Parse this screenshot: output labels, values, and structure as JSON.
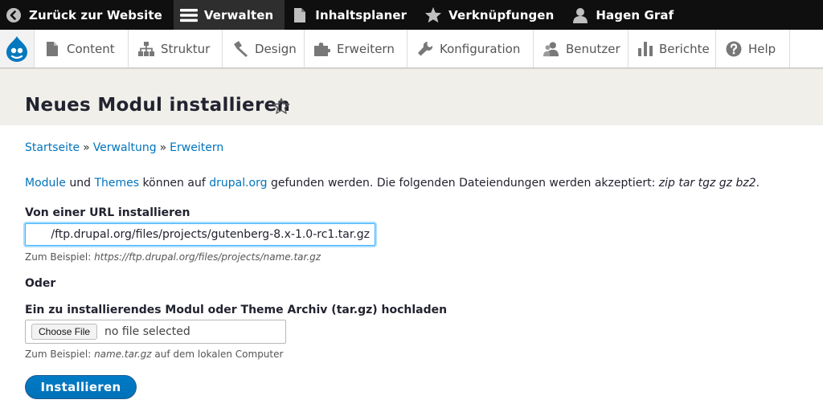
{
  "toolbar": {
    "back_label": "Zurück zur Website",
    "manage_label": "Verwalten",
    "content_planner_label": "Inhaltsplaner",
    "shortcuts_label": "Verknüpfungen",
    "user_label": "Hagen Graf"
  },
  "admin_menu": {
    "items": [
      {
        "label": "Content",
        "icon": "page-icon"
      },
      {
        "label": "Struktur",
        "icon": "structure-icon"
      },
      {
        "label": "Design",
        "icon": "brush-icon"
      },
      {
        "label": "Erweitern",
        "icon": "puzzle-icon"
      },
      {
        "label": "Konfiguration",
        "icon": "wrench-icon"
      },
      {
        "label": "Benutzer",
        "icon": "people-icon"
      },
      {
        "label": "Berichte",
        "icon": "bar-chart-icon"
      },
      {
        "label": "Help",
        "icon": "help-icon"
      }
    ]
  },
  "page": {
    "title": "Neues Modul installieren"
  },
  "breadcrumb": {
    "items": [
      "Startseite",
      "Verwaltung",
      "Erweitern"
    ],
    "separator": "»"
  },
  "intro": {
    "link_modules": "Module",
    "text_and": "und",
    "link_themes": "Themes",
    "text_found_on": "können auf",
    "link_drupal": "drupal.org",
    "text_found": "gefunden werden. Die folgenden Dateiendungen werden akzeptiert:",
    "extensions": "zip tar tgz gz bz2",
    "period": "."
  },
  "url_section": {
    "label": "Von einer URL installieren",
    "value": "/ftp.drupal.org/files/projects/gutenberg-8.x-1.0-rc1.tar.gz",
    "example_prefix": "Zum Beispiel:",
    "example_value": "https://ftp.drupal.org/files/projects/name.tar.gz"
  },
  "or_label": "Oder",
  "upload_section": {
    "label": "Ein zu installierendes Modul oder Theme Archiv (tar.gz) hochladen",
    "choose_button": "Choose File",
    "file_status": "no file selected",
    "example_prefix": "Zum Beispiel:",
    "example_value": "name.tar.gz",
    "example_suffix": "auf dem lokalen Computer"
  },
  "install_button": "Installieren",
  "colors": {
    "link": "#0074bd",
    "primary_button": "#0071b8",
    "toolbar_bg": "#0f0f0f"
  }
}
